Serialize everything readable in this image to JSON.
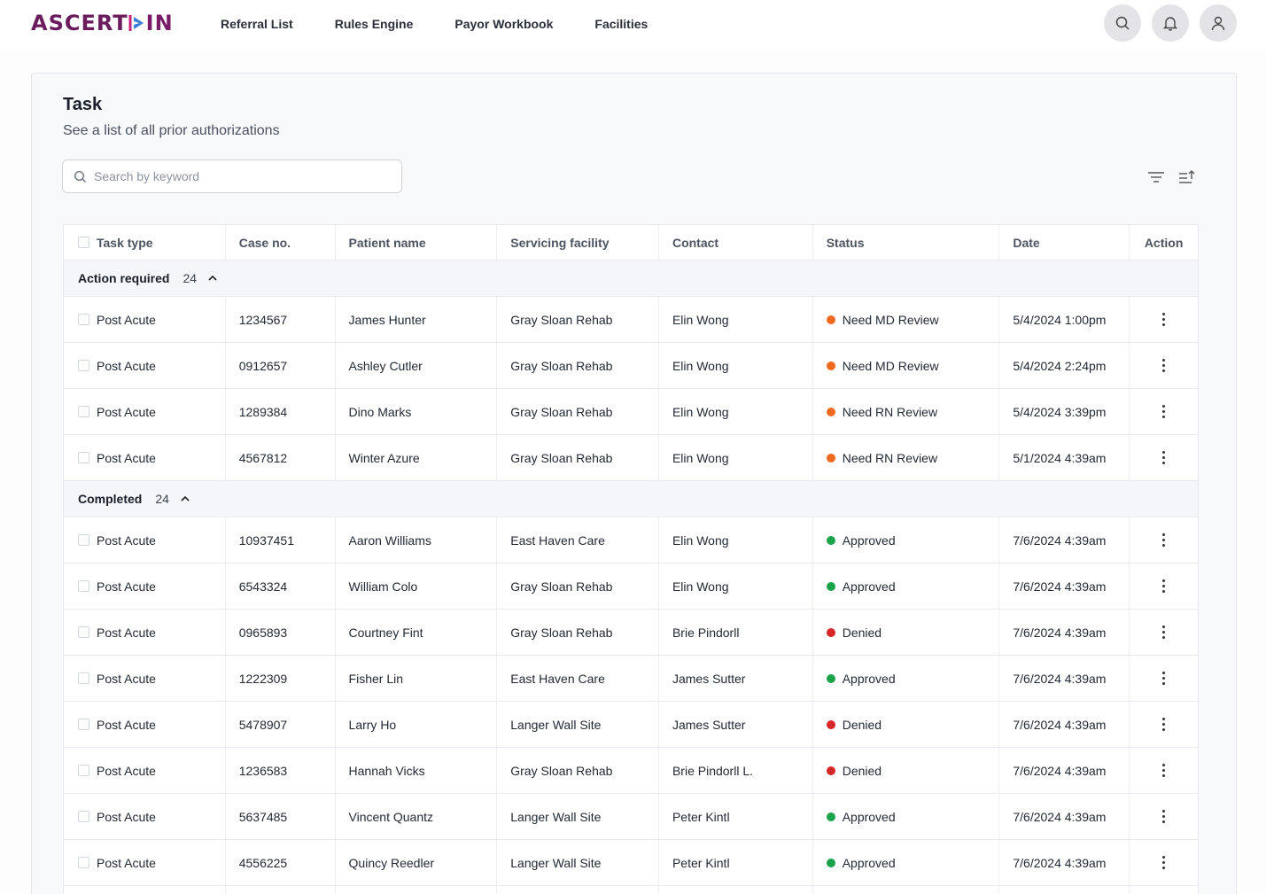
{
  "brand": {
    "name_part1": "ASCERT",
    "name_part2": "IN"
  },
  "nav": [
    "Referral List",
    "Rules Engine",
    "Payor Workbook",
    "Facilities"
  ],
  "header_icons": [
    "search-icon",
    "bell-icon",
    "user-icon"
  ],
  "page": {
    "title": "Task",
    "subtitle": "See a list of all prior authorizations"
  },
  "search": {
    "placeholder": "Search by keyword"
  },
  "columns": [
    "Task type",
    "Case no.",
    "Patient name",
    "Servicing facility",
    "Contact",
    "Status",
    "Date",
    "Action"
  ],
  "status_colors": {
    "need": "#f06a1d",
    "approved": "#1aa34a",
    "denied": "#d92626"
  },
  "groups": [
    {
      "label": "Action required",
      "count": "24",
      "rows": [
        {
          "task": "Post Acute",
          "case": "1234567",
          "patient": "James Hunter",
          "facility": "Gray Sloan Rehab",
          "contact": "Elin Wong",
          "status": "Need MD Review",
          "status_kind": "need",
          "date": "5/4/2024 1:00pm"
        },
        {
          "task": "Post Acute",
          "case": "0912657",
          "patient": "Ashley Cutler",
          "facility": "Gray Sloan Rehab",
          "contact": "Elin Wong",
          "status": "Need MD Review",
          "status_kind": "need",
          "date": "5/4/2024 2:24pm"
        },
        {
          "task": "Post Acute",
          "case": "1289384",
          "patient": "Dino Marks",
          "facility": "Gray Sloan Rehab",
          "contact": "Elin Wong",
          "status": "Need RN Review",
          "status_kind": "need",
          "date": "5/4/2024 3:39pm"
        },
        {
          "task": "Post Acute",
          "case": "4567812",
          "patient": "Winter Azure",
          "facility": "Gray Sloan Rehab",
          "contact": "Elin Wong",
          "status": "Need RN Review",
          "status_kind": "need",
          "date": "5/1/2024 4:39am"
        }
      ]
    },
    {
      "label": "Completed",
      "count": "24",
      "rows": [
        {
          "task": "Post Acute",
          "case": "10937451",
          "patient": "Aaron Williams",
          "facility": "East Haven Care",
          "contact": "Elin Wong",
          "status": "Approved",
          "status_kind": "approved",
          "date": "7/6/2024 4:39am"
        },
        {
          "task": "Post Acute",
          "case": "6543324",
          "patient": "William Colo",
          "facility": "Gray Sloan Rehab",
          "contact": "Elin Wong",
          "status": "Approved",
          "status_kind": "approved",
          "date": "7/6/2024 4:39am"
        },
        {
          "task": "Post Acute",
          "case": "0965893",
          "patient": "Courtney Fint",
          "facility": "Gray Sloan Rehab",
          "contact": "Brie Pindorll",
          "status": "Denied",
          "status_kind": "denied",
          "date": "7/6/2024 4:39am"
        },
        {
          "task": "Post Acute",
          "case": "1222309",
          "patient": "Fisher Lin",
          "facility": "East Haven Care",
          "contact": "James Sutter",
          "status": "Approved",
          "status_kind": "approved",
          "date": "7/6/2024 4:39am"
        },
        {
          "task": "Post Acute",
          "case": "5478907",
          "patient": "Larry Ho",
          "facility": "Langer Wall Site",
          "contact": "James Sutter",
          "status": "Denied",
          "status_kind": "denied",
          "date": "7/6/2024 4:39am"
        },
        {
          "task": "Post Acute",
          "case": "1236583",
          "patient": "Hannah Vicks",
          "facility": "Gray Sloan Rehab",
          "contact": "Brie Pindorll L.",
          "status": "Denied",
          "status_kind": "denied",
          "date": "7/6/2024 4:39am"
        },
        {
          "task": "Post Acute",
          "case": "5637485",
          "patient": "Vincent Quantz",
          "facility": "Langer Wall Site",
          "contact": "Peter Kintl",
          "status": "Approved",
          "status_kind": "approved",
          "date": "7/6/2024 4:39am"
        },
        {
          "task": "Post Acute",
          "case": "4556225",
          "patient": "Quincy Reedler",
          "facility": "Langer Wall Site",
          "contact": "Peter Kintl",
          "status": "Approved",
          "status_kind": "approved",
          "date": "7/6/2024 4:39am"
        },
        {
          "task": "",
          "case": "",
          "patient": "",
          "facility": "",
          "contact": "",
          "status": "",
          "status_kind": "",
          "date": ""
        }
      ]
    }
  ]
}
